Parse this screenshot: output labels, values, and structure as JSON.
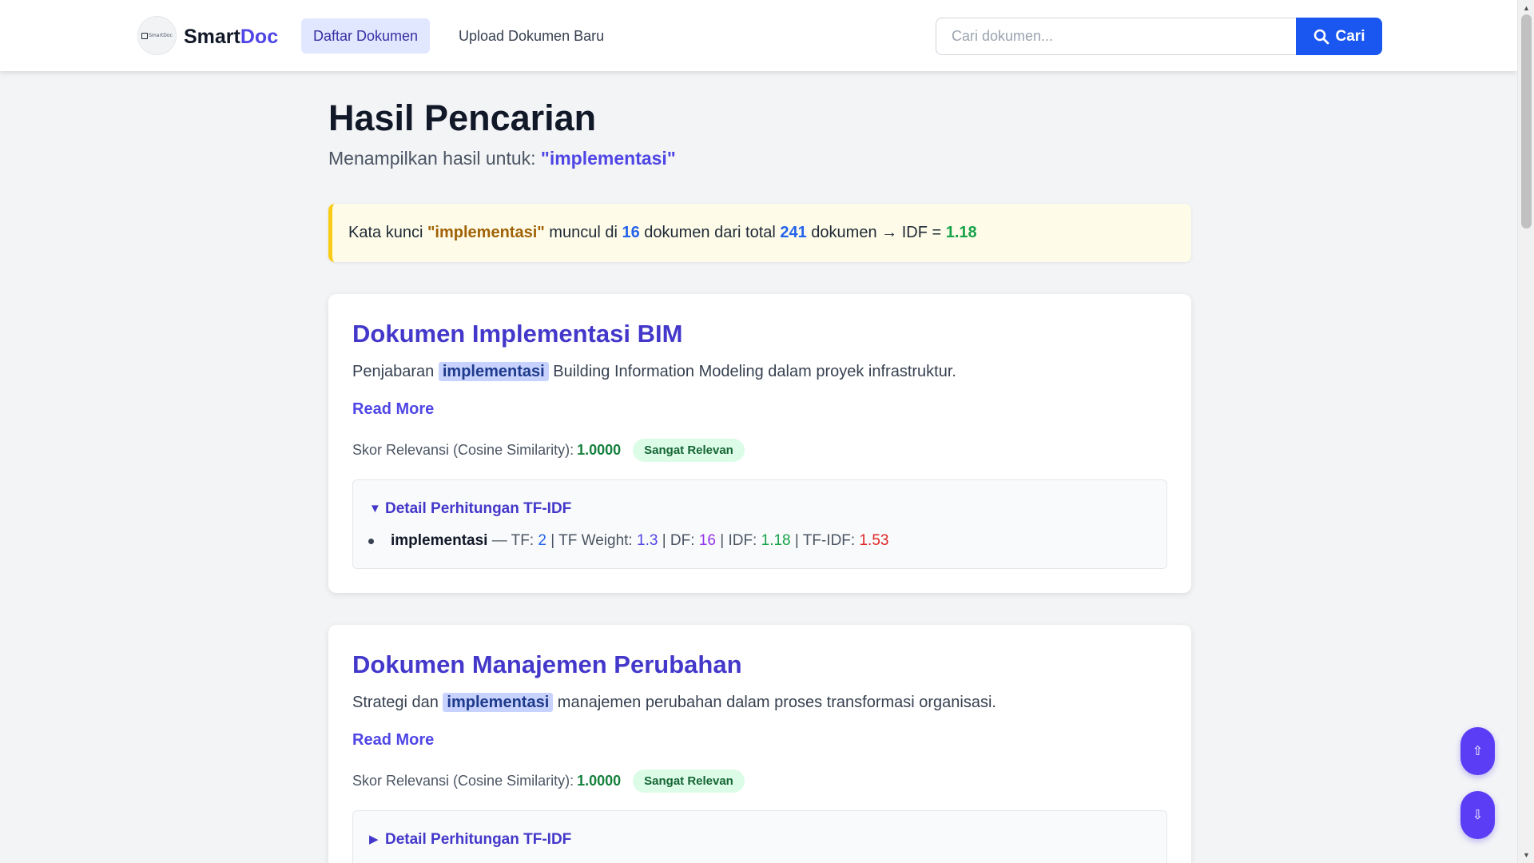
{
  "nav": {
    "logo_mini_text": "SmartDoc",
    "brand_part1": "Smart",
    "brand_part2": "Doc",
    "links": [
      {
        "label": "Daftar Dokumen",
        "active": true
      },
      {
        "label": "Upload Dokumen Baru",
        "active": false
      }
    ],
    "search_placeholder": "Cari dokumen...",
    "search_button": "Cari"
  },
  "header": {
    "title": "Hasil Pencarian",
    "subtitle_prefix": "Menampilkan hasil untuk: ",
    "query_display": "\"implementasi\""
  },
  "idf_info": {
    "part1": "Kata kunci ",
    "keyword": "\"implementasi\"",
    "part2": " muncul di ",
    "df": "16",
    "part3": " dokumen dari total ",
    "total": "241",
    "part4": " dokumen → IDF = ",
    "idf": "1.18"
  },
  "results": [
    {
      "title": "Dokumen Implementasi BIM",
      "desc_before": "Penjabaran ",
      "desc_highlight": "implementasi",
      "desc_after": " Building Information Modeling dalam proyek infrastruktur.",
      "read_more": "Read More",
      "score_label": "Skor Relevansi (Cosine Similarity):",
      "score": "1.0000",
      "badge": "Sangat Relevan",
      "details_label": "Detail Perhitungan TF-IDF",
      "details_open": true,
      "details_marker": "▼",
      "term": {
        "name": "implementasi",
        "sep": " — TF: ",
        "tf": "2",
        "tfw_label": " | TF Weight: ",
        "tf_weight": "1.3",
        "df_label": " | DF: ",
        "df": "16",
        "idf_label": " | IDF: ",
        "idf": "1.18",
        "tfidf_label": " | TF-IDF: ",
        "tfidf": "1.53"
      }
    },
    {
      "title": "Dokumen Manajemen Perubahan",
      "desc_before": "Strategi dan ",
      "desc_highlight": "implementasi",
      "desc_after": " manajemen perubahan dalam proses transformasi organisasi.",
      "read_more": "Read More",
      "score_label": "Skor Relevansi (Cosine Similarity):",
      "score": "1.0000",
      "badge": "Sangat Relevan",
      "details_label": "Detail Perhitungan TF-IDF",
      "details_open": false,
      "details_marker": "▶"
    }
  ],
  "fab": {
    "up": "⇧",
    "down": "⇩"
  },
  "colors": {
    "accent": "#4f46e5",
    "search_button": "#1a56f0",
    "fab": "#5b3df5",
    "idf_border": "#facc15"
  },
  "icons": {
    "search": "search-icon",
    "scroll_top": "arrow-up-icon",
    "scroll_bottom": "arrow-down-icon"
  }
}
